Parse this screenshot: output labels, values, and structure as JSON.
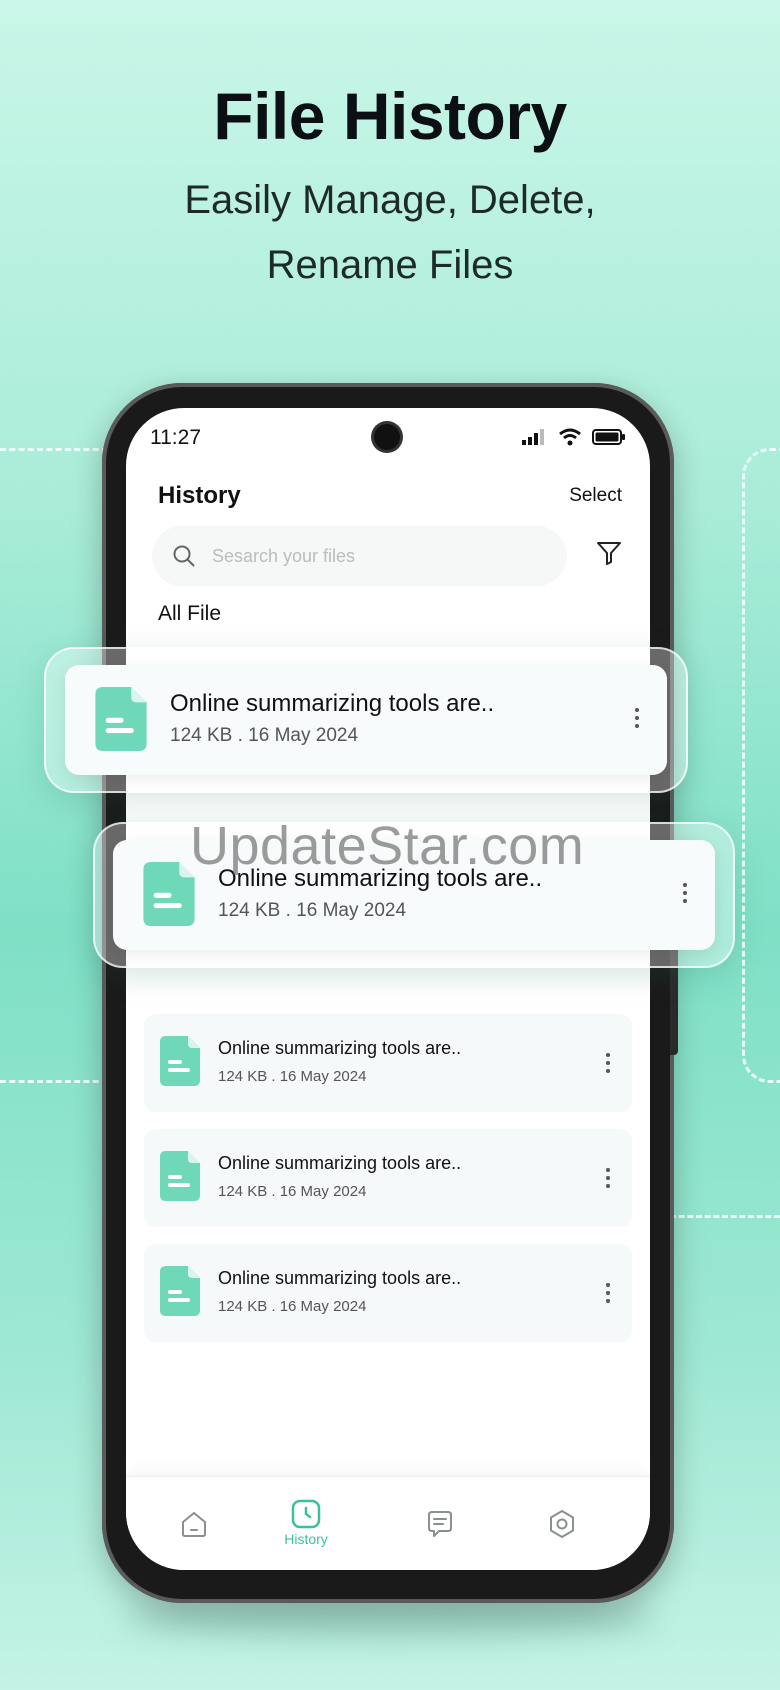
{
  "promo": {
    "headline": "File History",
    "subline_1": "Easily Manage, Delete,",
    "subline_2": "Rename Files"
  },
  "status_bar": {
    "time": "11:27",
    "icons": [
      "signal-icon",
      "wifi-icon",
      "battery-icon"
    ]
  },
  "header": {
    "title": "History",
    "select_label": "Select"
  },
  "search": {
    "placeholder": "Sesarch your files",
    "value": ""
  },
  "section_label": "All File",
  "floating_files": [
    {
      "title": "Online summarizing tools are..",
      "meta": "124 KB . 16 May 2024"
    },
    {
      "title": "Online summarizing tools are..",
      "meta": "124 KB . 16 May 2024"
    }
  ],
  "files": [
    {
      "title": "Online summarizing tools are..",
      "meta": "124 KB . 16 May 2024"
    },
    {
      "title": "Online summarizing tools are..",
      "meta": "124 KB . 16 May 2024"
    },
    {
      "title": "Online summarizing tools are..",
      "meta": "124 KB . 16 May 2024"
    }
  ],
  "bottom_nav": [
    {
      "icon": "home-icon",
      "label": ""
    },
    {
      "icon": "history-icon",
      "label": "History",
      "active": true
    },
    {
      "icon": "chat-icon",
      "label": ""
    },
    {
      "icon": "settings-icon",
      "label": ""
    }
  ],
  "watermark": "UpdateStar.com",
  "colors": {
    "accent": "#3bbf9e",
    "doc_icon": "#6fd8b8",
    "background_top": "#c9f6e8",
    "background_mid": "#7fe0c6"
  }
}
